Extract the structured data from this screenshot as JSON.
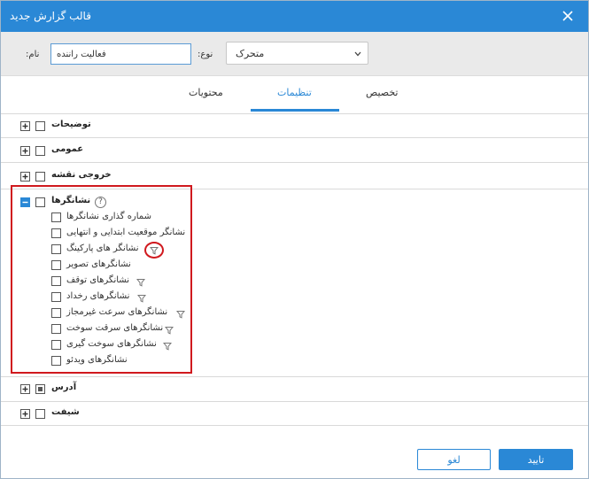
{
  "dialog": {
    "title": "قالب گزارش جدید"
  },
  "form": {
    "name_label": ":نام",
    "name_value": "فعالیت راننده",
    "type_label": ":نوع",
    "type_value": "متحرک"
  },
  "tabs": [
    {
      "label": "تخصیص"
    },
    {
      "label": "تنظیمات"
    },
    {
      "label": "محتویات"
    }
  ],
  "sections": {
    "descriptions": "توضیحات",
    "general": "عمومی",
    "map_output": "خروجی نقشه",
    "markers": "نشانگرها",
    "address": "آدرس",
    "shift": "شیفت"
  },
  "marker_items": [
    "شماره گذاری نشانگرها",
    "نشانگر موقعیت ابتدایی و انتهایی",
    "نشانگر های پارکینگ",
    "نشانگرهای تصویر",
    "نشانگرهای توقف",
    "نشانگرهای رخداد",
    "نشانگرهای سرعت غیرمجاز",
    "نشانگرهای سرقت سوخت",
    "نشانگرهای سوخت گیری",
    "نشانگرهای ویدئو"
  ],
  "help_glyph": "?",
  "buttons": {
    "cancel": "لغو",
    "ok": "تایید"
  },
  "colors": {
    "accent": "#2a88d6",
    "highlight": "#d0191e"
  }
}
